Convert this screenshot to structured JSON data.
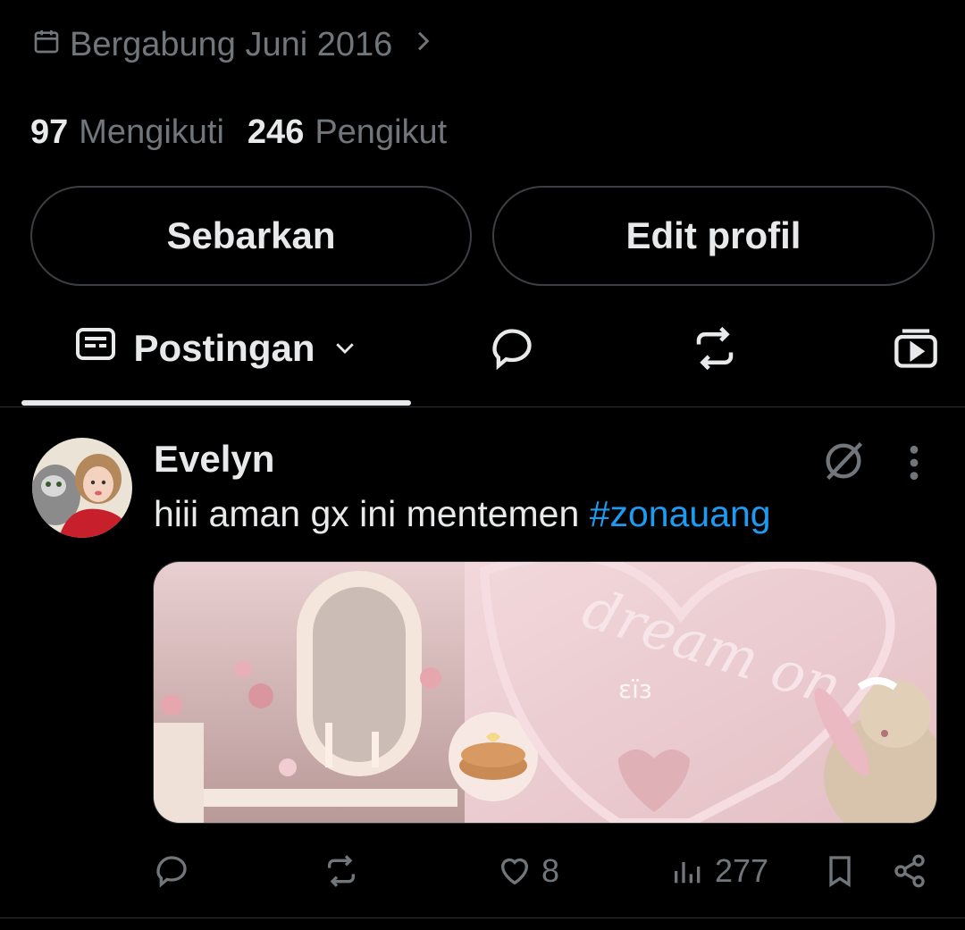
{
  "profile": {
    "joined": "Bergabung Juni 2016",
    "following_count": "97",
    "following_label": "Mengikuti",
    "followers_count": "246",
    "followers_label": "Pengikut"
  },
  "buttons": {
    "share": "Sebarkan",
    "edit": "Edit profil"
  },
  "tabs": {
    "active_label": "Postingan"
  },
  "tweet": {
    "author": "Evelyn",
    "text": "hiii aman gx ini mentemen ",
    "hashtag": "#zonauang",
    "media_text": "dream on",
    "media_small_text": "ɛïɜ",
    "likes": "8",
    "views": "277"
  },
  "colors": {
    "accent": "#1d9bf0",
    "muted": "#71767b",
    "text": "#e7e9ea",
    "bg": "#000000"
  }
}
